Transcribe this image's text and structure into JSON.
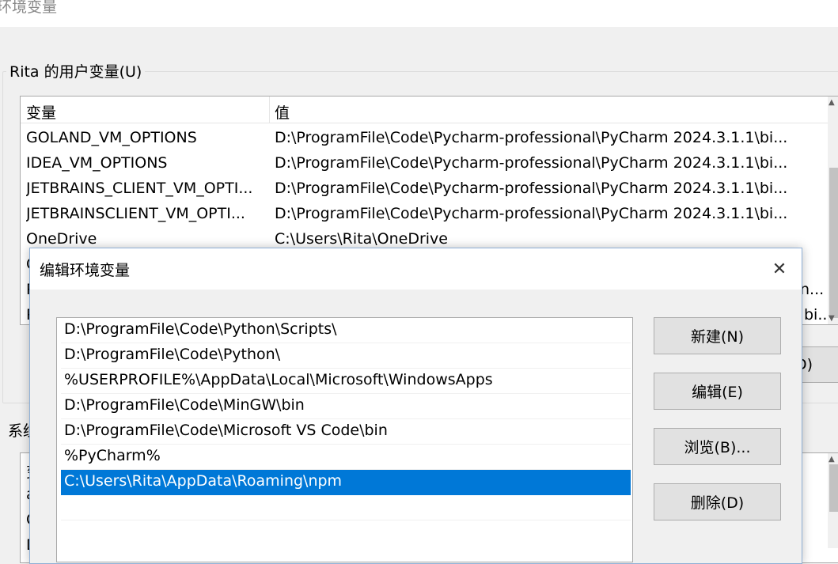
{
  "background_window": {
    "title": "环境变量",
    "user_group_label": "Rita 的用户变量(U)",
    "header": {
      "col1": "变量",
      "col2": "值"
    },
    "rows": [
      {
        "name": "GOLAND_VM_OPTIONS",
        "value": "D:\\ProgramFile\\Code\\Pycharm-professional\\PyCharm 2024.3.1.1\\bi..."
      },
      {
        "name": "IDEA_VM_OPTIONS",
        "value": "D:\\ProgramFile\\Code\\Pycharm-professional\\PyCharm 2024.3.1.1\\bi..."
      },
      {
        "name": "JETBRAINS_CLIENT_VM_OPTI...",
        "value": "D:\\ProgramFile\\Code\\Pycharm-professional\\PyCharm 2024.3.1.1\\bi..."
      },
      {
        "name": "JETBRAINSCLIENT_VM_OPTI...",
        "value": "D:\\ProgramFile\\Code\\Pycharm-professional\\PyCharm 2024.3.1.1\\bi..."
      },
      {
        "name": "OneDrive",
        "value": "C:\\Users\\Rita\\OneDrive"
      },
      {
        "name": "C",
        "value": ""
      },
      {
        "name": "P",
        "value": "n..."
      },
      {
        "name": "P",
        "value": "bi..."
      }
    ],
    "partial_button_label": "D)",
    "system_group_label": "系统",
    "system_rows": [
      "变",
      "a",
      "C",
      "D"
    ]
  },
  "dialog": {
    "title": "编辑环境变量",
    "close_glyph": "✕",
    "paths": [
      "D:\\ProgramFile\\Code\\Python\\Scripts\\",
      "D:\\ProgramFile\\Code\\Python\\",
      "%USERPROFILE%\\AppData\\Local\\Microsoft\\WindowsApps",
      "D:\\ProgramFile\\Code\\MinGW\\bin",
      "D:\\ProgramFile\\Code\\Microsoft VS Code\\bin",
      "%PyCharm%",
      "C:\\Users\\Rita\\AppData\\Roaming\\npm"
    ],
    "selected_index": 6,
    "buttons": {
      "new": "新建(N)",
      "edit": "编辑(E)",
      "browse": "浏览(B)...",
      "delete": "删除(D)"
    }
  },
  "colors": {
    "selection": "#0078d7",
    "window_bg": "#f0f0f0",
    "button_bg": "#e1e1e1"
  }
}
